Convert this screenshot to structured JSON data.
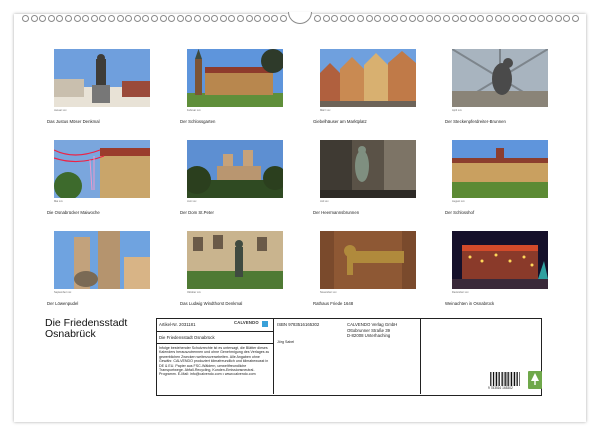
{
  "thumbnails": [
    {
      "caption": "Das Justus Möser Denkmal",
      "credit": "Januar xxx"
    },
    {
      "caption": "Der Schlossgarten",
      "credit": "Februar xxx"
    },
    {
      "caption": "Giebelhäuser am Marktplatz",
      "credit": "März xxx"
    },
    {
      "caption": "Der Steckenpferdreiter-Brunnen",
      "credit": "April xxx"
    },
    {
      "caption": "Die Osnabrücker Maiwoche",
      "credit": "Mai xxx"
    },
    {
      "caption": "Der Dom St.Peter",
      "credit": "Juni xxx"
    },
    {
      "caption": "Der Heermannsbrunnen",
      "credit": "Juli xxx"
    },
    {
      "caption": "Der Schlosshof",
      "credit": "August xxx"
    },
    {
      "caption": "Der Löwenpudel",
      "credit": "September xxx"
    },
    {
      "caption": "Das Ludwig Windthorst Denkmal",
      "credit": "Oktober xxx"
    },
    {
      "caption": "Rathaus Friede 1648",
      "credit": "November xxx"
    },
    {
      "caption": "Weinachten in Osnabrück",
      "credit": "Dezember xxx"
    }
  ],
  "cover": {
    "title_line1": "Die Friedensstadt",
    "title_line2": "Osnabrück"
  },
  "info": {
    "article": "Artikel-Nr. 2031181",
    "brand": "CALVENDO",
    "brand_sub": "",
    "product_title": "Die Friedensstadt Osnabrück",
    "isbn": "ISBN 9783516165302",
    "author": "Jörg Sabel",
    "publisher_line1": "CALVENDO Verlag GmbH",
    "publisher_line2": "Ottobrunner Straße 39",
    "publisher_line3": "D-82008 Unterhaching",
    "legal": "Infolge bestehender Schutzrechte ist es untersagt, die Blätter dieses Kalenders herauszutrennen und ohne Genehmigung des Verlages zu gewerblichen Zwecken weiterzuverarbeiten. Alle Angaben ohne Gewähr. CALVENDO produziert klimafreundlich und klimabewusst in DE & EU. Papier aus FSC-Wäldern, umweltfreundliche Transportwege. Abfall-Recycling, Kunden-Emissionsneutral-Programm. E-Mail: info@calvendo.com • www.calvendo.com",
    "barcode_number": "9 783516 165302"
  },
  "colors": {
    "sky": "#5b8fd6",
    "brick": "#b5744a",
    "sandstone": "#c8a878",
    "night": "#1a1030"
  }
}
